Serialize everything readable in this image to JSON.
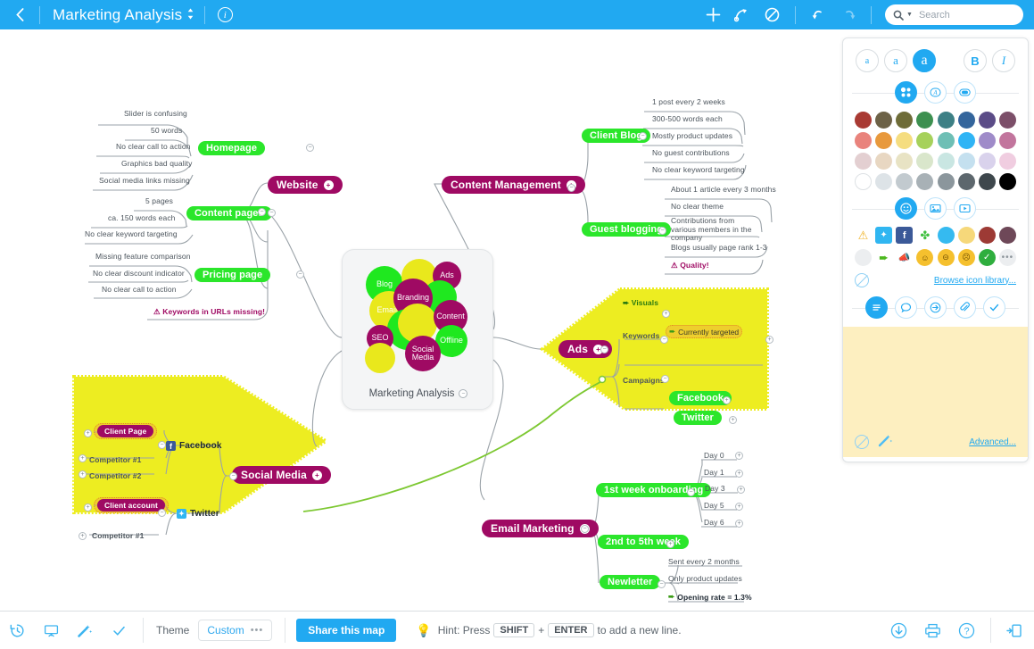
{
  "topbar": {
    "back_icon": "chevron-left-icon",
    "title": "Marketing Analysis",
    "title_caret": "↕",
    "info_icon": "i",
    "add_icon": "+",
    "relationship_icon": "relationship-arrow-icon",
    "boundary_icon": "boundary-icon",
    "undo_icon": "↶",
    "redo_icon": "↷",
    "search_placeholder": "Search",
    "search_value": "",
    "accent": "#21a9f1"
  },
  "left_tools": [
    {
      "name": "zoom-in",
      "glyph": "+"
    },
    {
      "name": "zoom-out",
      "glyph": "−"
    },
    {
      "name": "fit-map",
      "glyph": "✲"
    },
    {
      "name": "settings",
      "glyph": "⚙"
    }
  ],
  "map": {
    "center": {
      "title": "Marketing Analysis",
      "bubbles": [
        {
          "label": "Blog",
          "color": "green"
        },
        {
          "label": "Ads",
          "color": "magenta"
        },
        {
          "label": "Branding",
          "color": "magenta"
        },
        {
          "label": "Emails",
          "color": "yellow"
        },
        {
          "label": "Content",
          "color": "magenta"
        },
        {
          "label": "SEO",
          "color": "magenta"
        },
        {
          "label": "Offline",
          "color": "green"
        },
        {
          "label": "Social Media",
          "color": "magenta"
        }
      ]
    },
    "branches": {
      "website": {
        "label": "Website",
        "children": [
          {
            "label": "Homepage",
            "leaves": [
              "Slider is confusing",
              "50 words",
              "No clear call to action",
              "Graphics bad quality",
              "Social media links missing"
            ]
          },
          {
            "label": "Content pages",
            "leaves": [
              "5 pages",
              "ca. 150 words each",
              "No clear keyword targeting"
            ]
          },
          {
            "label": "Pricing page",
            "leaves": [
              "Missing feature comparison",
              "No clear discount indicator",
              "No clear call to action"
            ]
          }
        ],
        "alert": "Keywords in URLs missing!"
      },
      "content_management": {
        "label": "Content Management",
        "children": [
          {
            "label": "Client Blog",
            "leaves": [
              "1 post every 2 weeks",
              "300-500 words each",
              "Mostly product updates",
              "No guest contributions",
              "No clear keyword targeting"
            ]
          },
          {
            "label": "Guest blogging",
            "leaves": [
              "About 1 article every 3 months",
              "No clear theme",
              "Contributions from various members in the company",
              "Blogs usually page rank 1-3",
              "Quality!"
            ]
          }
        ]
      },
      "ads": {
        "label": "Ads",
        "children": [
          {
            "label": "Visuals"
          },
          {
            "label": "Keywords",
            "leaves": [
              "Currently targeted"
            ]
          },
          {
            "label": "Campaigns",
            "leaves": [
              "Facebook",
              "Twitter"
            ]
          }
        ]
      },
      "social_media": {
        "label": "Social Media",
        "children": [
          {
            "label": "Facebook",
            "leaves": [
              "Client Page",
              "Competitor #1",
              "Competitor #2"
            ]
          },
          {
            "label": "Twitter",
            "leaves": [
              "Client account",
              "Competitor #1"
            ]
          }
        ]
      },
      "email_marketing": {
        "label": "Email Marketing",
        "children": [
          {
            "label": "1st week onboarding",
            "leaves": [
              "Day 0",
              "Day 1",
              "Day 3",
              "Day 5",
              "Day 6"
            ]
          },
          {
            "label": "2nd to 5th week",
            "leaves": []
          },
          {
            "label": "Newletter",
            "leaves": [
              "Sent every 2 months",
              "Only product updates",
              "Opening rate = 1.3%"
            ]
          }
        ]
      }
    }
  },
  "panel": {
    "font_sizes": [
      "a",
      "a",
      "a"
    ],
    "bold_label": "B",
    "italic_label": "I",
    "modes": [
      "color-palette-icon",
      "text-color-icon",
      "fill-color-icon"
    ],
    "colors_row1": [
      "#a93a33",
      "#6d6247",
      "#6e6c38",
      "#3d9050",
      "#3d8085",
      "#34659c",
      "#5b4c87",
      "#7c4f69"
    ],
    "colors_row2": [
      "#e9837c",
      "#e8993c",
      "#f5dd80",
      "#a6d15b",
      "#6ebfb5",
      "#2fb4f5",
      "#9f8bc9",
      "#c2759d"
    ],
    "colors_row3": [
      "#e3cfd1",
      "#e8d7c2",
      "#e8e3c4",
      "#d9e6cb",
      "#c9e6e2",
      "#c4e0ef",
      "#d9d2ec",
      "#f0cde0"
    ],
    "colors_row4": [
      "#ffffff",
      "#dde3e7",
      "#c2cacf",
      "#a8b1b6",
      "#8b969c",
      "#5d676d",
      "#3e474c",
      "#000000"
    ],
    "icon_tabs": [
      "emoji-icon",
      "image-icon",
      "video-icon"
    ],
    "icons_row1": [
      "warning-icon",
      "twitter-icon",
      "facebook-icon",
      "clover-icon",
      "blue-dot-icon",
      "yellow-dot-icon",
      "red-dot-icon",
      "purple-dot-icon"
    ],
    "icons_row2": [
      "gray-dot-icon",
      "green-arrow-icon",
      "megaphone-icon",
      "smile-icon",
      "neutral-icon",
      "sad-icon",
      "check-icon",
      "more-icon"
    ],
    "no_icon_label": "no-icon",
    "browse_label": "Browse icon library...",
    "note_tabs": [
      "notes-icon",
      "comment-icon",
      "link-icon",
      "attachment-icon",
      "task-icon"
    ],
    "note_text": "",
    "clear_label": "clear-note-icon",
    "wand_label": "auto-format-icon",
    "advanced_label": "Advanced..."
  },
  "bottombar": {
    "icons_left": [
      "history-icon",
      "presentation-icon",
      "magic-wand-icon",
      "check-icon"
    ],
    "theme_label": "Theme",
    "theme_value": "Custom",
    "theme_dots": "…",
    "share_label": "Share this map",
    "hint_prefix": "Hint: Press",
    "hint_key1": "SHIFT",
    "hint_plus": "+",
    "hint_key2": "ENTER",
    "hint_suffix": "to add a new line.",
    "icons_right": [
      "download-icon",
      "print-icon",
      "help-icon"
    ],
    "collapse_icon": "collapse-panel-icon"
  }
}
